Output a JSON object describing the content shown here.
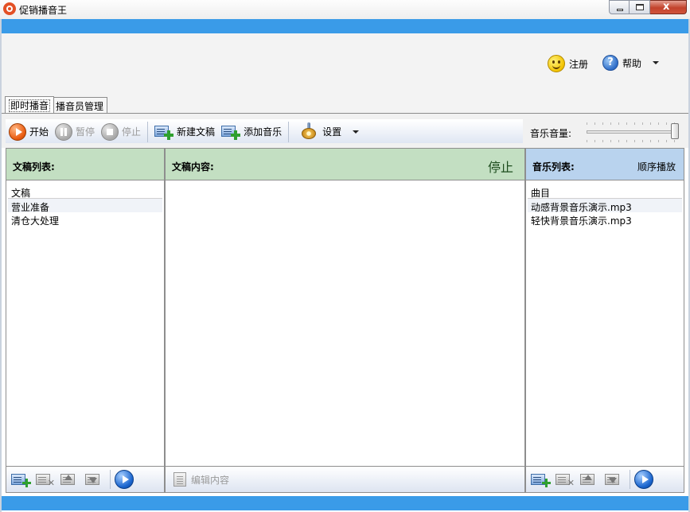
{
  "window": {
    "title": "促销播音王",
    "min_label": "",
    "max_label": "",
    "close_label": "x"
  },
  "header": {
    "register_label": "注册",
    "help_label": "帮助"
  },
  "tabs": [
    {
      "label": "即时播音",
      "active": true
    },
    {
      "label": "播音员管理",
      "active": false
    }
  ],
  "toolbar": {
    "start_label": "开始",
    "pause_label": "暂停",
    "stop_label": "停止",
    "new_script_label": "新建文稿",
    "add_music_label": "添加音乐",
    "settings_label": "设置",
    "volume_label": "音乐音量:",
    "volume_level": 1.0
  },
  "scripts_panel": {
    "title": "文稿列表:",
    "column_header": "文稿",
    "items": [
      "营业准备",
      "清仓大处理"
    ]
  },
  "content_panel": {
    "title": "文稿内容:",
    "status": "停止",
    "edit_label": "编辑内容"
  },
  "music_panel": {
    "title": "音乐列表:",
    "mode": "顺序播放",
    "column_header": "曲目",
    "items": [
      "动感背景音乐演示.mp3",
      "轻快背景音乐演示.mp3"
    ]
  },
  "colors": {
    "accent_blue": "#3a9be8",
    "header_green": "#c3dfc2",
    "header_blue": "#b9d3ee"
  }
}
